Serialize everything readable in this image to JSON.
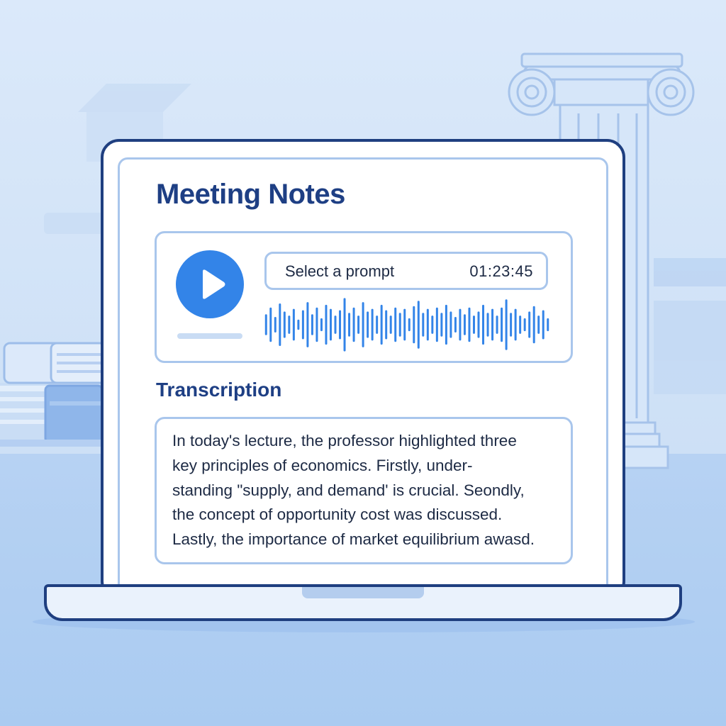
{
  "app": {
    "title": "Meeting Notes"
  },
  "player": {
    "prompt_label": "Select a prompt",
    "timestamp": "01:23:45",
    "play_icon": "play-icon",
    "progress": 0
  },
  "waveform": {
    "bar_heights": [
      0.35,
      0.6,
      0.25,
      0.75,
      0.45,
      0.3,
      0.55,
      0.15,
      0.5,
      0.8,
      0.35,
      0.6,
      0.2,
      0.7,
      0.55,
      0.3,
      0.5,
      0.95,
      0.4,
      0.6,
      0.3,
      0.8,
      0.45,
      0.55,
      0.3,
      0.7,
      0.5,
      0.3,
      0.6,
      0.4,
      0.55,
      0.2,
      0.65,
      0.85,
      0.4,
      0.55,
      0.3,
      0.6,
      0.4,
      0.7,
      0.45,
      0.25,
      0.55,
      0.35,
      0.6,
      0.3,
      0.45,
      0.7,
      0.4,
      0.55,
      0.3,
      0.6,
      0.9,
      0.4,
      0.55,
      0.3,
      0.2,
      0.45,
      0.65,
      0.3,
      0.5,
      0.2
    ],
    "color": "#3384e8"
  },
  "transcription": {
    "heading": "Transcription",
    "lines": [
      "In today's lecture, the professor highlighted three",
      "key principles of economics. Firstly, under-",
      "standing \"supply, and demand' is crucial. Seondly,",
      "the concept of opportunity cost was discussed.",
      "Lastly, the importance of market equilibrium awasd."
    ]
  },
  "colors": {
    "accent": "#3384e8",
    "heading": "#1e3f84",
    "border": "#a9c6ec",
    "frame": "#1f3f80"
  }
}
